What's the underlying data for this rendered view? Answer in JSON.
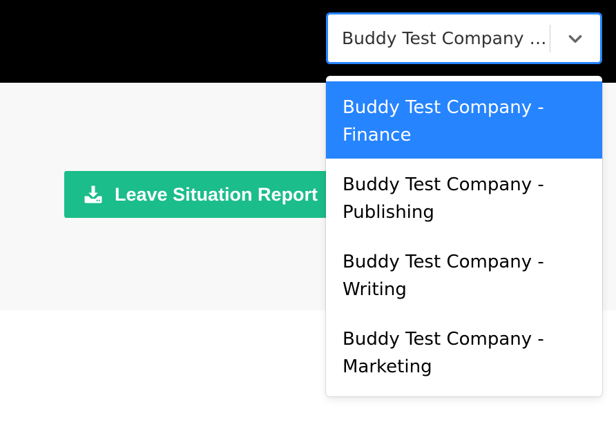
{
  "select": {
    "current_value": "Buddy Test Company - Finance",
    "options": [
      {
        "label": "Buddy Test Company - Finance",
        "selected": true
      },
      {
        "label": "Buddy Test Company - Publishing",
        "selected": false
      },
      {
        "label": "Buddy Test Company - Writing",
        "selected": false
      },
      {
        "label": "Buddy Test Company - Marketing",
        "selected": false
      }
    ]
  },
  "actions": {
    "report_button_label": "Leave Situation Report",
    "report_button_icon": "download-icon"
  },
  "colors": {
    "topbar": "#000000",
    "content_band": "#f8f8f8",
    "report_button": "#1bbd8a",
    "focus_accent": "#2684ff",
    "selected_option": "#2684ff"
  }
}
